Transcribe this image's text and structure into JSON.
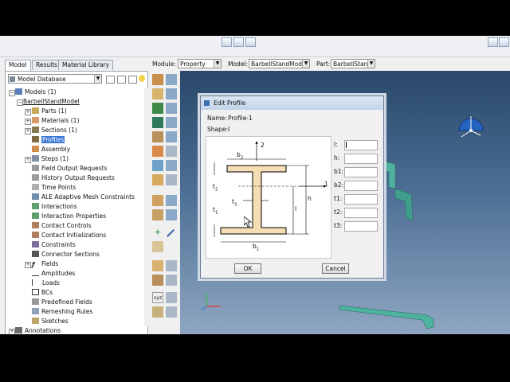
{
  "tabs": [
    "Model",
    "Results",
    "Material Library"
  ],
  "context": {
    "module_label": "Module:",
    "module_value": "Property",
    "model_label": "Model:",
    "model_value": "BarbellStandModel",
    "part_label": "Part:",
    "part_value": "BarbellStand"
  },
  "tree": {
    "database": "Model Database",
    "items": [
      "Models (1)",
      "BarbellStandModel",
      "Parts (1)",
      "Materials (1)",
      "Sections (1)",
      "Profiles",
      "Assembly",
      "Steps (1)",
      "Field Output Requests",
      "History Output Requests",
      "Time Points",
      "ALE Adaptive Mesh Constraints",
      "Interactions",
      "Interaction Properties",
      "Contact Controls",
      "Contact Initializations",
      "Constraints",
      "Connector Sections",
      "Fields",
      "Amplitudes",
      "Loads",
      "BCs",
      "Predefined Fields",
      "Remeshing Rules",
      "Sketches",
      "Annotations"
    ]
  },
  "dialog": {
    "title": "Edit Profile",
    "name_label": "Name:",
    "name_value": "Profile-1",
    "shape_label": "Shape:",
    "shape_value": "I",
    "fields": [
      "l:",
      "h:",
      "b1:",
      "b2:",
      "t1:",
      "t2:",
      "t3:"
    ],
    "ok": "OK",
    "cancel": "Cancel",
    "diagram": {
      "axis2": "2",
      "axis1": "1",
      "b2": "b",
      "b2_sub": "2",
      "b1": "b",
      "b1_sub": "1",
      "t2": "t",
      "t2_sub": "2",
      "t3": "t",
      "t3_sub": "3",
      "t1": "t",
      "t1_sub": "1",
      "l": "l",
      "h": "h"
    }
  },
  "colors": {
    "viewport_top": "#29486a",
    "viewport_bottom": "#8ea6c1",
    "part_fill": "#4fb2a0",
    "section_fill": "#f5deb3",
    "selection": "#3a77d6"
  }
}
